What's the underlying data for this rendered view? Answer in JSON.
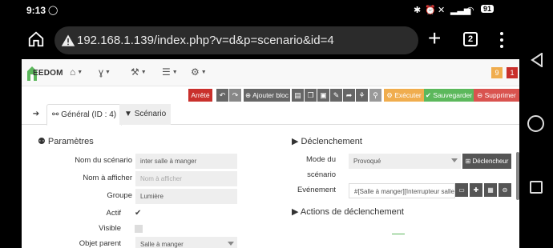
{
  "status_bar": {
    "time": "9:13",
    "battery": "91"
  },
  "browser": {
    "url": "192.168.1.139/index.php?v=d&p=scenario&id=4",
    "tab_count": "2"
  },
  "app": {
    "logo_text": "EEDOM",
    "badges": [
      "9",
      "1"
    ],
    "colors": {
      "stop": "#c9302c",
      "execute": "#f0ad4e",
      "save": "#5cb85c",
      "delete": "#d9534f",
      "dark": "#666666"
    }
  },
  "toolbar": {
    "status_label": "Arrêté",
    "add_block_label": "Ajouter bloc",
    "execute_label": "Exécuter",
    "save_label": "Sauvegarder",
    "delete_label": "Supprimer"
  },
  "tabs": {
    "general": "Général (ID : 4)",
    "scenario": "Scénario"
  },
  "params": {
    "title": "Paramètres",
    "name_label": "Nom du scénario",
    "name_value": "inter salle à manger",
    "display_label": "Nom à afficher",
    "display_placeholder": "Nom à afficher",
    "group_label": "Groupe",
    "group_value": "Lumière",
    "active_label": "Actif",
    "visible_label": "Visible",
    "parent_label": "Objet parent",
    "parent_value": "Salle à manger"
  },
  "trigger": {
    "title": "Déclenchement",
    "mode_label_1": "Mode du",
    "mode_label_2": "scénario",
    "mode_value": "Provoqué",
    "trigger_button": "Déclencheur",
    "event_label": "Evénement",
    "event_value": "#[Salle à manger][Interrupteur salle",
    "actions_title": "Actions de déclenchement"
  }
}
